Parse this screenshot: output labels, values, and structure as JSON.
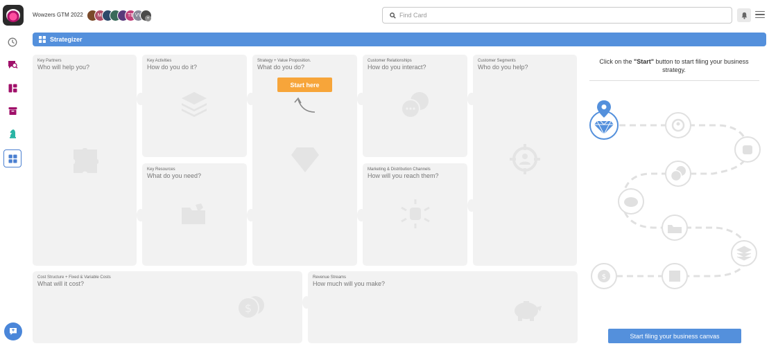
{
  "app": {
    "project_name": "Wowzers GTM 2022",
    "avatars": [
      {
        "initials": "",
        "color": "#7a4a2a"
      },
      {
        "initials": "Mi",
        "color": "#b0506a"
      },
      {
        "initials": "",
        "color": "#2e4a6a"
      },
      {
        "initials": "",
        "color": "#3a6a5a"
      },
      {
        "initials": "",
        "color": "#5a3a7a"
      },
      {
        "initials": "TE",
        "color": "#c0407a"
      },
      {
        "initials": "VV",
        "color": "#8a8a9a"
      },
      {
        "initials": "",
        "color": "#4a4a4a"
      }
    ],
    "avatar_extra_count": "+",
    "search_placeholder": "Find Card"
  },
  "sidebar": {
    "items": [
      {
        "name": "recent",
        "icon": "clock-icon",
        "color": "#777777"
      },
      {
        "name": "cards",
        "icon": "chat-search-icon",
        "color": "#a0106a"
      },
      {
        "name": "boards",
        "icon": "board-icon",
        "color": "#a0106a"
      },
      {
        "name": "archive",
        "icon": "archive-icon",
        "color": "#a0106a"
      },
      {
        "name": "strategy",
        "icon": "chess-knight-icon",
        "color": "#2ab5a5"
      },
      {
        "name": "strategizer",
        "icon": "grid-icon",
        "color": "#4a7fd0",
        "active": true
      }
    ]
  },
  "header": {
    "title": "Strategizer"
  },
  "canvas": {
    "key_partners": {
      "sub": "Key Partners",
      "question": "Who will help you?"
    },
    "key_activities": {
      "sub": "Key Activities",
      "question": "How do you do it?"
    },
    "key_resources": {
      "sub": "Key Resources",
      "question": "What do you need?"
    },
    "value_proposition": {
      "sub": "Strategy + Value Proposition.",
      "question": "What do you do?"
    },
    "customer_relationships": {
      "sub": "Customer Relationships",
      "question": "How do you interact?"
    },
    "channels": {
      "sub": "Marketing & Distribution Channels",
      "question": "How will you reach them?"
    },
    "customer_segments": {
      "sub": "Customer Segments",
      "question": "Who do you help?"
    },
    "cost_structure": {
      "sub": "Cost Structure + Fixed & Variable Costs",
      "question": "What will it cost?"
    },
    "revenue_streams": {
      "sub": "Revenue Streams",
      "question": "How much will you make?"
    },
    "start_here_label": "Start here"
  },
  "right_panel": {
    "instruction_prefix": "Click on the ",
    "instruction_bold": "\"Start\"",
    "instruction_suffix": " button to start filing your business strategy.",
    "button_label": "Start filing your business canvas"
  },
  "colors": {
    "accent_blue": "#5490dc",
    "start_orange": "#f7a53a",
    "brand_magenta": "#a0106a",
    "block_bg": "#f2f2f2"
  }
}
